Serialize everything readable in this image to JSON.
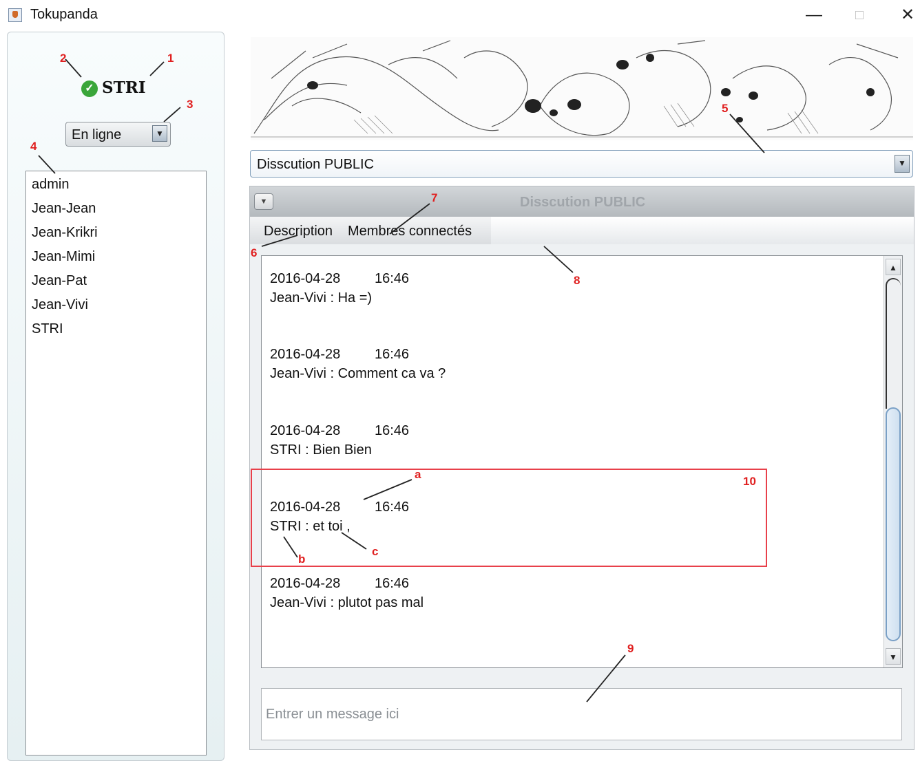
{
  "window": {
    "title": "Tokupanda",
    "controls": {
      "minimize": "—",
      "maximize": "□",
      "close": "✕"
    }
  },
  "left_panel": {
    "current_user": "STRI",
    "status_icon": "check-circle-icon",
    "status_select": {
      "selected": "En ligne"
    },
    "users": [
      "admin",
      "Jean-Jean",
      "Jean-Krikri",
      "Jean-Mimi",
      "Jean-Pat",
      "Jean-Vivi",
      "STRI"
    ]
  },
  "discussion_select": {
    "selected": "Disscution PUBLIC"
  },
  "discussion_panel": {
    "title": "Disscution PUBLIC",
    "menu": [
      "Description",
      "Membres connectés"
    ]
  },
  "messages": [
    {
      "date": "2016-04-28",
      "time": "16:46",
      "text": "Jean-Vivi : Ha =)"
    },
    {
      "date": "2016-04-28",
      "time": "16:46",
      "text": "Jean-Vivi : Comment ca va ?"
    },
    {
      "date": "2016-04-28",
      "time": "16:46",
      "text": "STRI : Bien Bien"
    },
    {
      "date": "2016-04-28",
      "time": "16:46",
      "text": "STRI : et toi ,"
    },
    {
      "date": "2016-04-28",
      "time": "16:46",
      "text": "Jean-Vivi : plutot pas mal"
    }
  ],
  "input": {
    "placeholder": "Entrer un message ici"
  },
  "annotations": {
    "n1": "1",
    "n2": "2",
    "n3": "3",
    "n4": "4",
    "n5": "5",
    "n6": "6",
    "n7": "7",
    "n8": "8",
    "n9": "9",
    "n10": "10",
    "a": "a",
    "b": "b",
    "c": "c"
  },
  "colors": {
    "annotation": "#e02020",
    "status_online": "#3aa63a",
    "scroll_thumb": "#7aa0c6"
  }
}
